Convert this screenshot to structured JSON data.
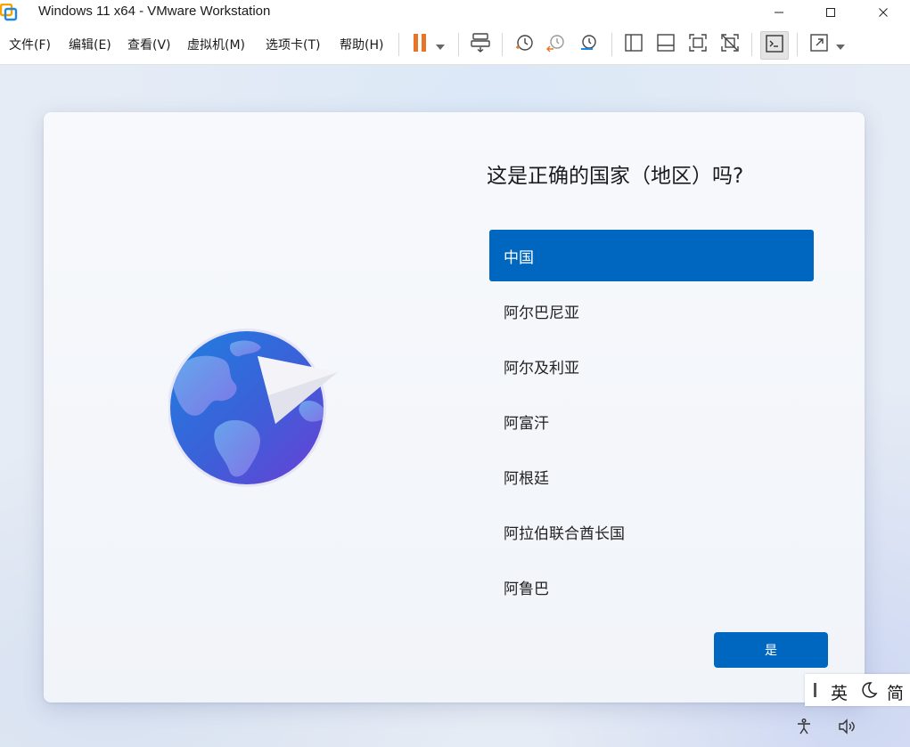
{
  "window": {
    "title": "Windows 11 x64 - VMware Workstation",
    "controls": [
      "minimize-icon",
      "maximize-icon",
      "close-icon"
    ]
  },
  "menu": {
    "items": [
      {
        "label": "文件(F)"
      },
      {
        "label": "编辑(E)"
      },
      {
        "label": "查看(V)"
      },
      {
        "label": "虚拟机(M)"
      },
      {
        "label": "选项卡(T)"
      },
      {
        "label": "帮助(H)"
      }
    ]
  },
  "toolbar": {
    "icons": [
      "pause-icon",
      "dropdown-arrow-icon",
      "send-ctrl-alt-del-icon",
      "snapshot-icon",
      "revert-snapshot-icon",
      "snapshot-manager-icon",
      "show-library-icon",
      "thumbnail-bar-icon",
      "full-screen-icon",
      "unity-icon",
      "console-view-icon",
      "stretch-guest-icon",
      "stretch-dropdown-icon"
    ],
    "pause_color": "#e8742a"
  },
  "oobe": {
    "question": "这是正确的国家（地区）吗?",
    "countries": [
      {
        "label": "中国",
        "selected": true
      },
      {
        "label": "阿尔巴尼亚",
        "selected": false
      },
      {
        "label": "阿尔及利亚",
        "selected": false
      },
      {
        "label": "阿富汗",
        "selected": false
      },
      {
        "label": "阿根廷",
        "selected": false
      },
      {
        "label": "阿拉伯联合酋长国",
        "selected": false
      },
      {
        "label": "阿鲁巴",
        "selected": false
      }
    ],
    "yes_label": "是",
    "accent_color": "#0067c0"
  },
  "ime": {
    "language": "英",
    "mode_icon": "moon-icon",
    "script": "简"
  },
  "system_icons": [
    "accessibility-icon",
    "volume-icon"
  ]
}
